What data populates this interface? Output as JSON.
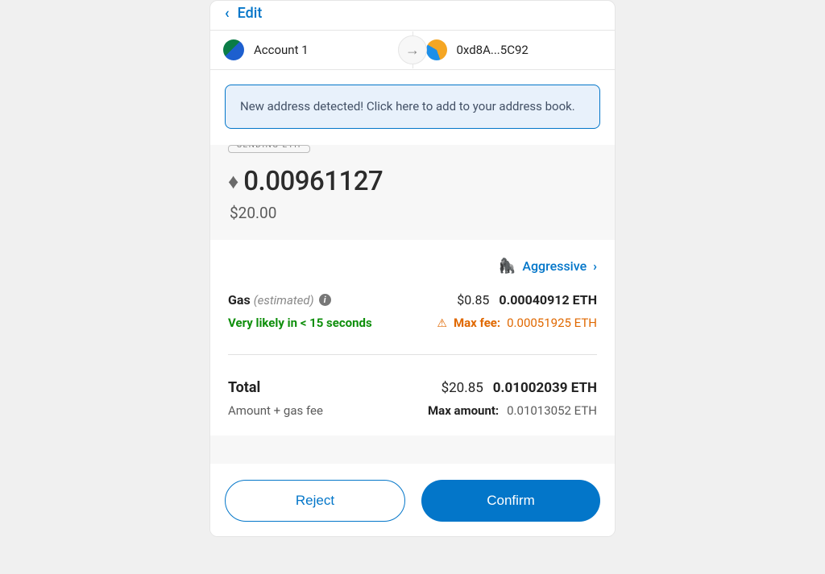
{
  "header": {
    "edit_label": "Edit"
  },
  "accounts": {
    "from_name": "Account 1",
    "to_address": "0xd8A...5C92"
  },
  "notice": {
    "text": "New address detected! Click here to add to your address book."
  },
  "sending": {
    "badge": "SENDING ETH",
    "eth_amount": "0.00961127",
    "usd_amount": "$20.00"
  },
  "gas": {
    "speed_label": "Aggressive",
    "label": "Gas",
    "estimated_suffix": "(estimated)",
    "usd": "$0.85",
    "eth": "0.00040912 ETH",
    "likely_text": "Very likely in < 15 seconds",
    "maxfee_label": "Max fee:",
    "maxfee_value": "0.00051925 ETH"
  },
  "total": {
    "label": "Total",
    "usd": "$20.85",
    "eth": "0.01002039 ETH",
    "subtext": "Amount + gas fee",
    "maxamount_label": "Max amount:",
    "maxamount_value": "0.01013052 ETH"
  },
  "buttons": {
    "reject": "Reject",
    "confirm": "Confirm"
  }
}
